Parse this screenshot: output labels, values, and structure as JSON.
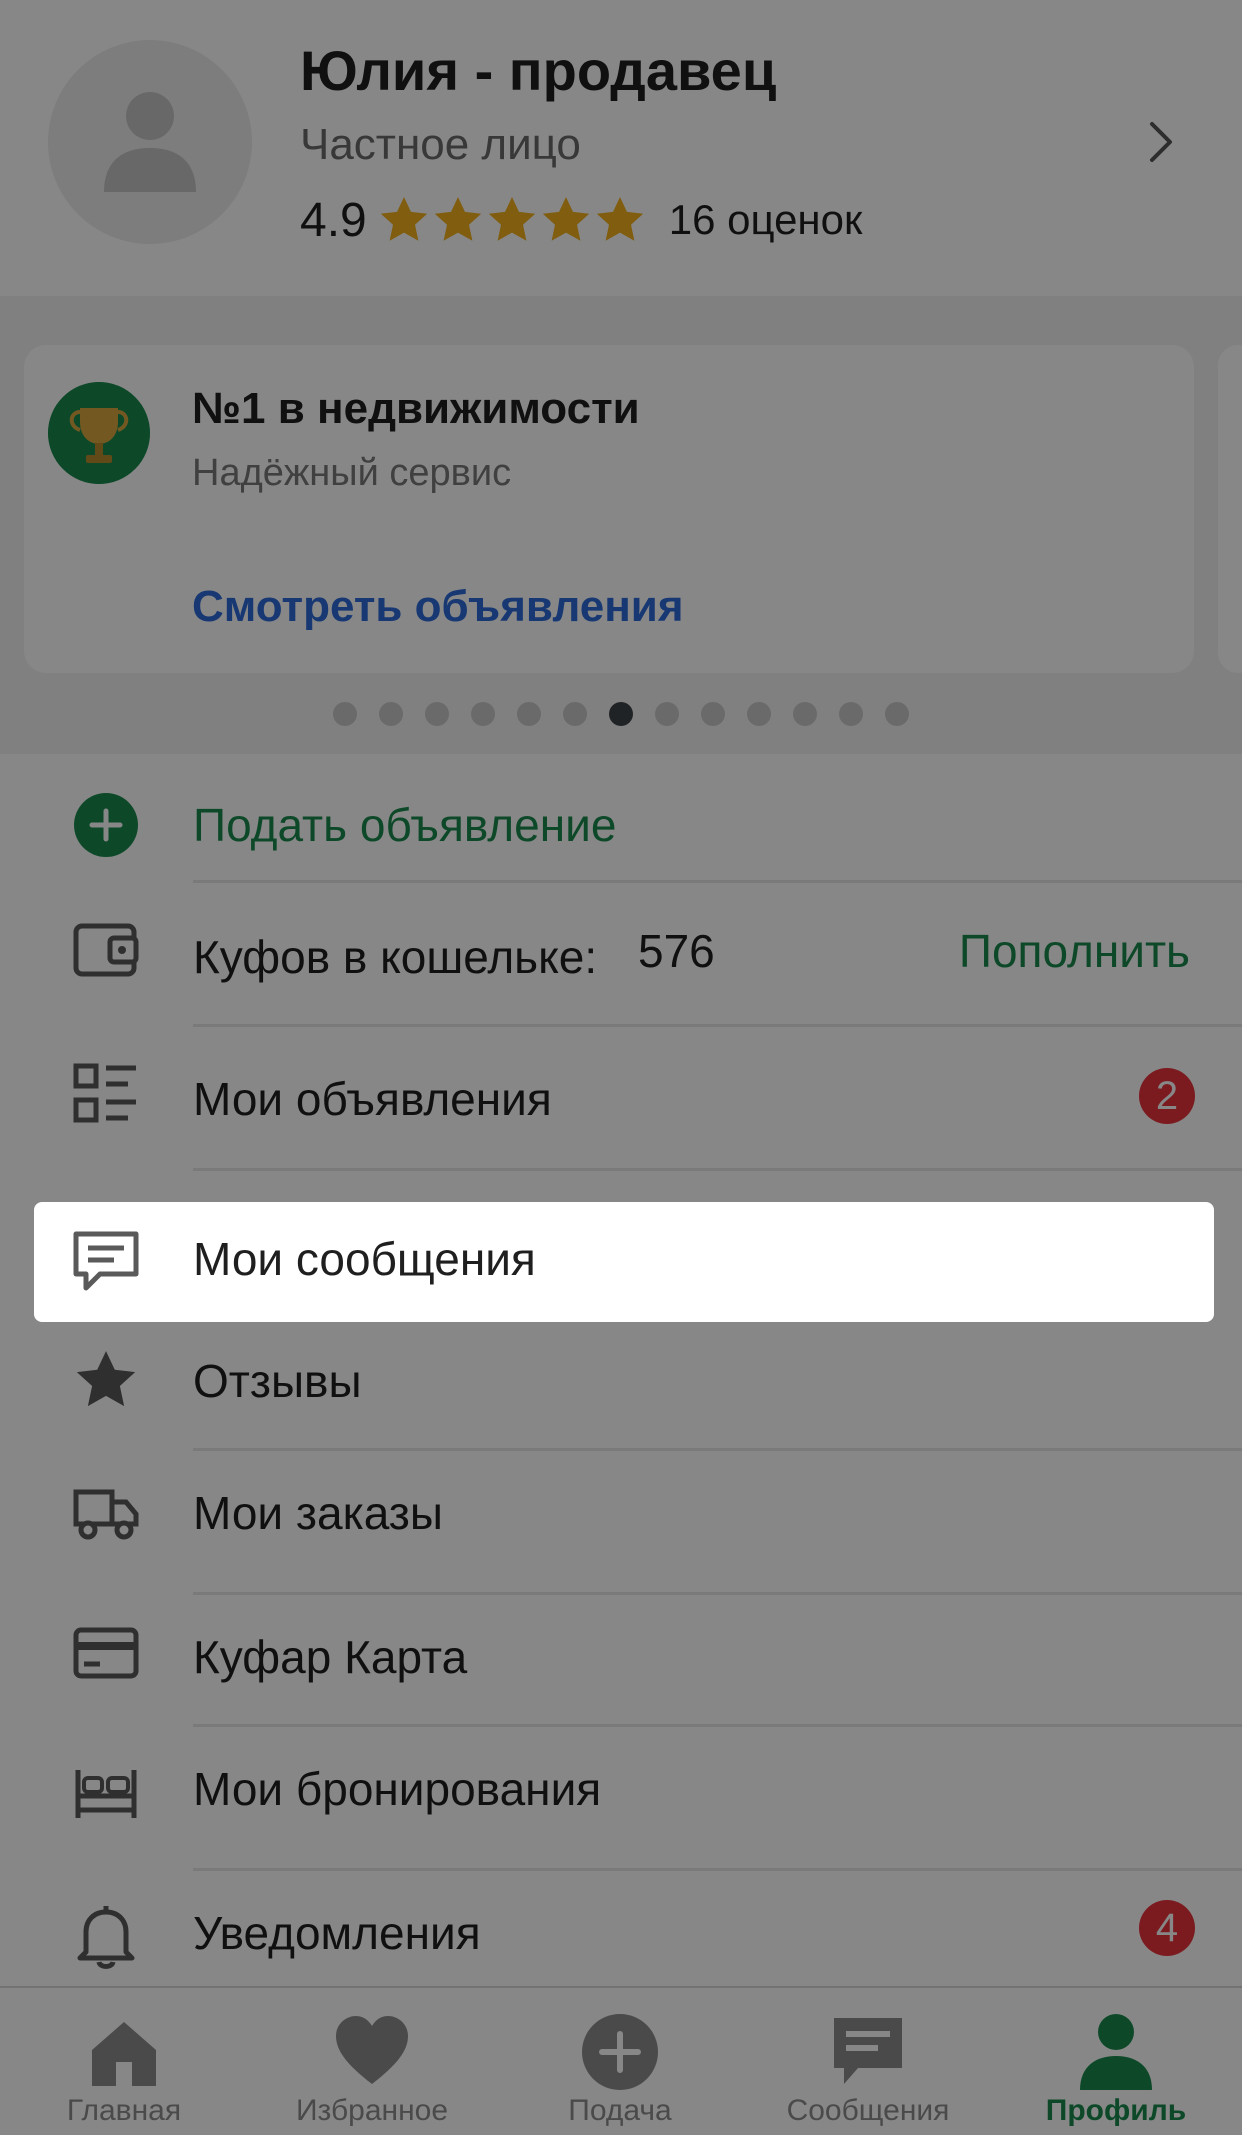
{
  "profile": {
    "name": "Юлия - продавец",
    "type": "Частное лицо",
    "rating": "4.9",
    "rating_count": "16 оценок",
    "stars_filled": 5,
    "star_color": "#f2b01e"
  },
  "promo": {
    "title": "№1 в недвижимости",
    "subtitle": "Надёжный сервис",
    "link": "Смотреть объявления",
    "dots_total": 13,
    "dots_active_index": 6
  },
  "menu": {
    "post_ad": "Подать объявление",
    "wallet_label": "Куфов в кошельке:",
    "wallet_amount": "576",
    "wallet_topup": "Пополнить",
    "my_ads": "Мои объявления",
    "my_ads_badge": "2",
    "my_messages": "Мои сообщения",
    "reviews": "Отзывы",
    "my_orders": "Мои заказы",
    "kufar_card": "Куфар Карта",
    "my_bookings": "Мои бронирования",
    "notifications": "Уведомления",
    "notifications_badge": "4"
  },
  "tabs": [
    {
      "label": "Главная",
      "icon": "home-icon"
    },
    {
      "label": "Избранное",
      "icon": "heart-icon"
    },
    {
      "label": "Подача",
      "icon": "plus-circle-icon"
    },
    {
      "label": "Сообщения",
      "icon": "chat-icon"
    },
    {
      "label": "Профиль",
      "icon": "person-icon",
      "active": true
    }
  ],
  "colors": {
    "accent_green": "#1a8a4e",
    "link_blue": "#2c6bd8",
    "badge_red": "#e9343d",
    "overlay": "rgba(0,0,0,0.47)"
  }
}
